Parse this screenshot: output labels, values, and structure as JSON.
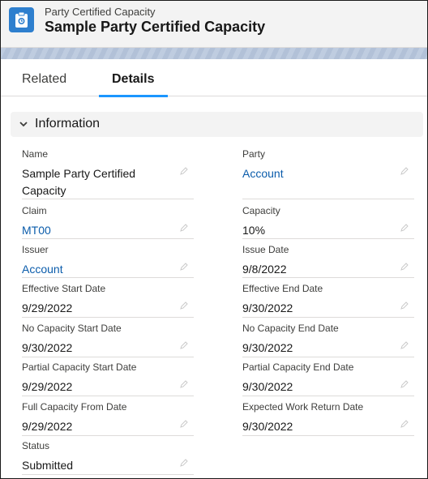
{
  "header": {
    "object_type": "Party Certified Capacity",
    "record_name": "Sample Party Certified Capacity",
    "icon": "clipboard-icon"
  },
  "tabs": [
    {
      "label": "Related",
      "active": false
    },
    {
      "label": "Details",
      "active": true
    }
  ],
  "section": {
    "title": "Information",
    "icon": "chevron-down-icon"
  },
  "fields": {
    "name": {
      "label": "Name",
      "value": "Sample Party Certified Capacity"
    },
    "party": {
      "label": "Party",
      "value": "Account"
    },
    "claim": {
      "label": "Claim",
      "value": "MT00"
    },
    "capacity": {
      "label": "Capacity",
      "value": "10%"
    },
    "issuer": {
      "label": "Issuer",
      "value": "Account"
    },
    "issue_date": {
      "label": "Issue Date",
      "value": "9/8/2022"
    },
    "effective_start": {
      "label": "Effective Start Date",
      "value": "9/29/2022"
    },
    "effective_end": {
      "label": "Effective End Date",
      "value": "9/30/2022"
    },
    "no_cap_start": {
      "label": "No Capacity Start Date",
      "value": "9/30/2022"
    },
    "no_cap_end": {
      "label": "No Capacity End Date",
      "value": "9/30/2022"
    },
    "partial_start": {
      "label": "Partial Capacity Start Date",
      "value": "9/29/2022"
    },
    "partial_end": {
      "label": "Partial Capacity End Date",
      "value": "9/30/2022"
    },
    "full_from": {
      "label": "Full Capacity From Date",
      "value": "9/29/2022"
    },
    "work_return": {
      "label": "Expected Work Return Date",
      "value": "9/30/2022"
    },
    "status": {
      "label": "Status",
      "value": "Submitted"
    }
  },
  "colors": {
    "brand": "#2e7fce",
    "link": "#0b5cab",
    "tab_accent": "#1b96ff"
  }
}
